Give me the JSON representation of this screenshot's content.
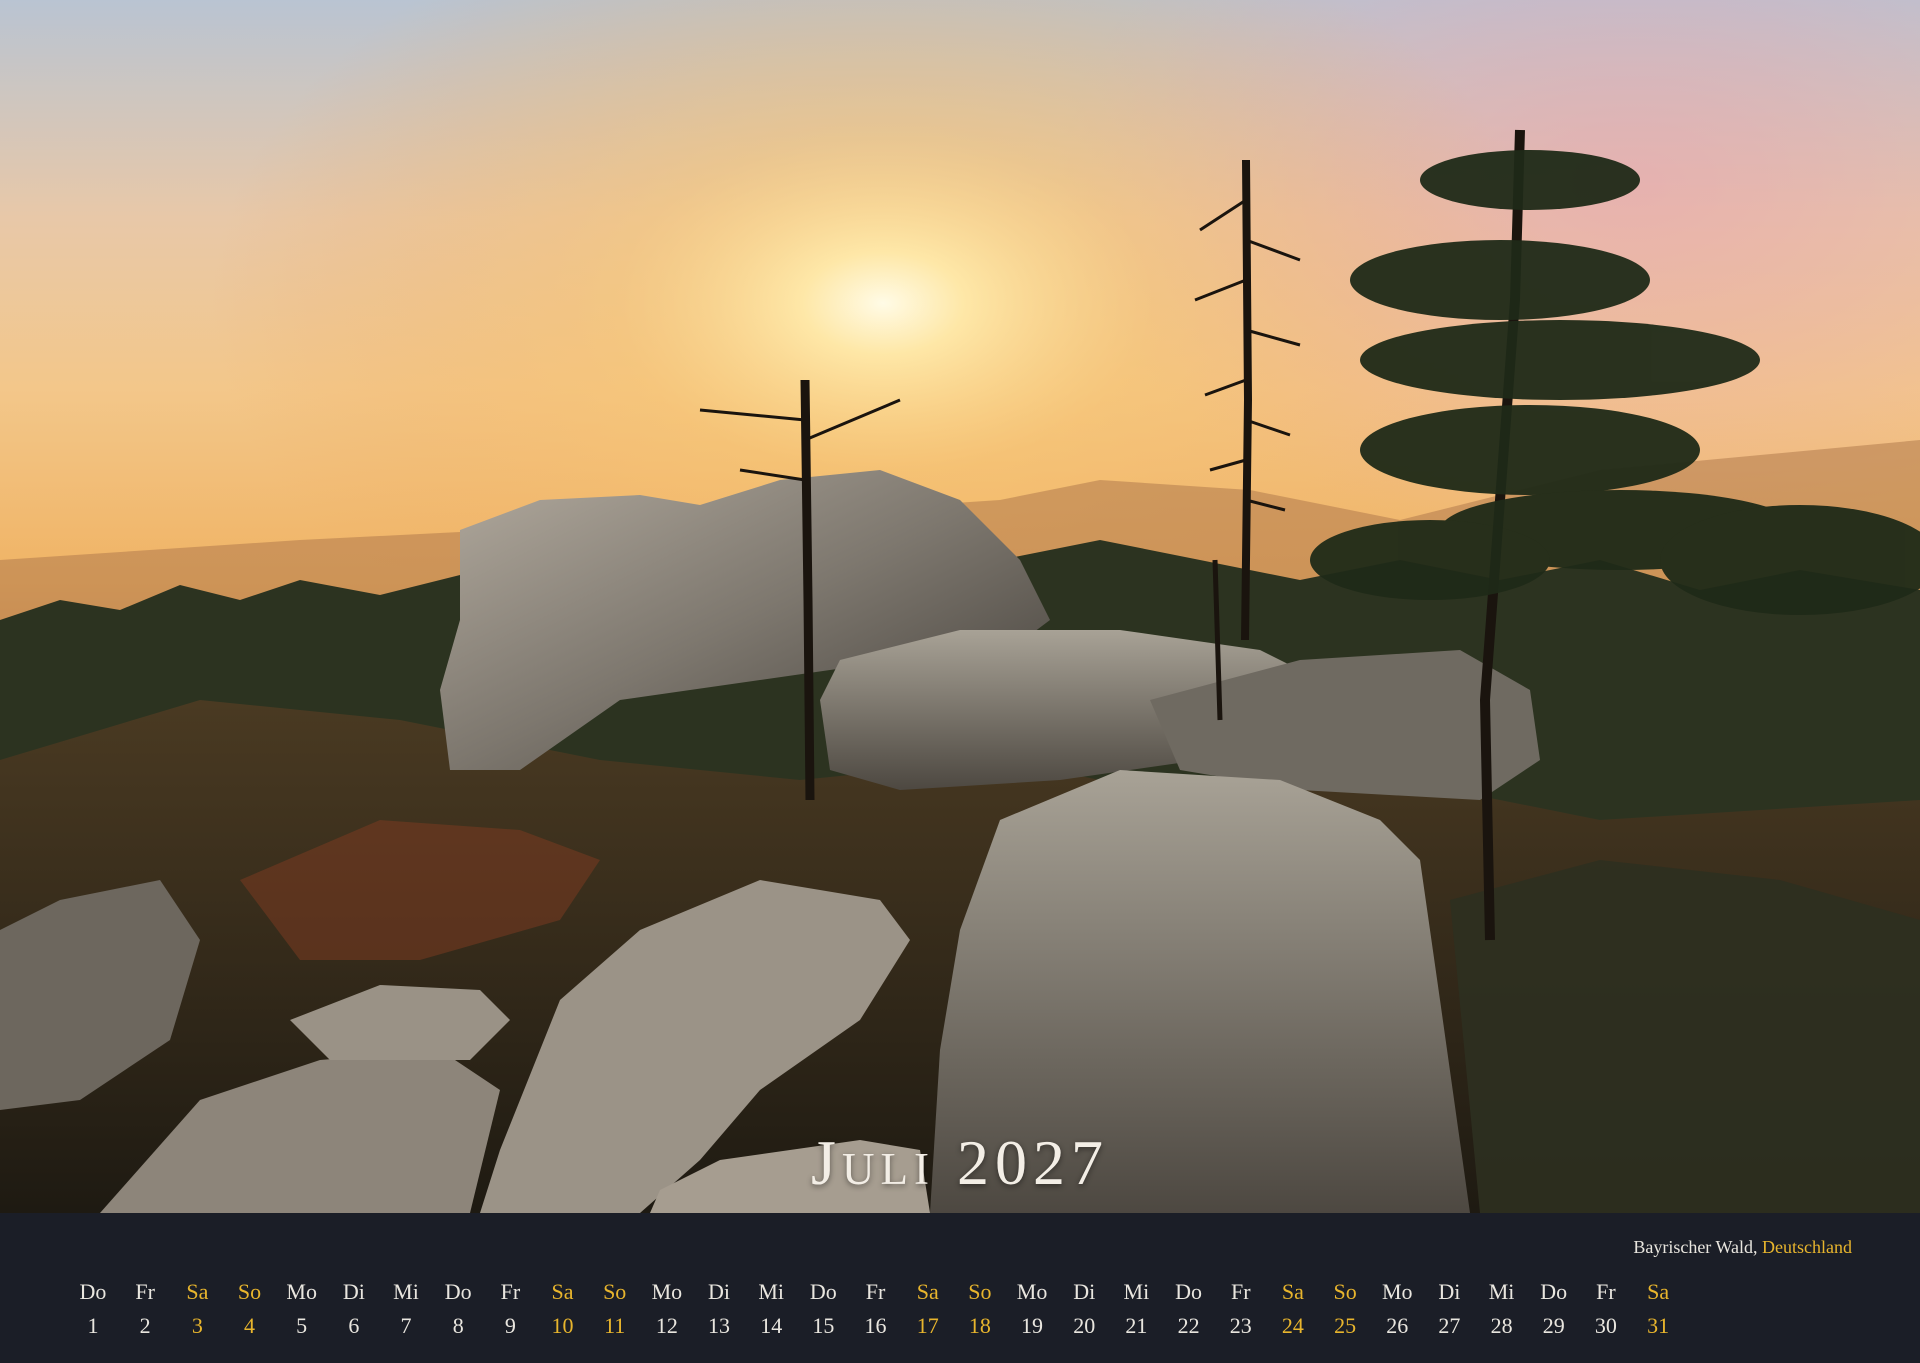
{
  "calendar": {
    "month": "Juli",
    "year": "2027",
    "location": "Bayrischer Wald,",
    "country": "Deutschland"
  },
  "days": [
    {
      "name": "Do",
      "date": "1",
      "weekend": false
    },
    {
      "name": "Fr",
      "date": "2",
      "weekend": false
    },
    {
      "name": "Sa",
      "date": "3",
      "weekend": true
    },
    {
      "name": "So",
      "date": "4",
      "weekend": true
    },
    {
      "name": "Mo",
      "date": "5",
      "weekend": false
    },
    {
      "name": "Di",
      "date": "6",
      "weekend": false
    },
    {
      "name": "Mi",
      "date": "7",
      "weekend": false
    },
    {
      "name": "Do",
      "date": "8",
      "weekend": false
    },
    {
      "name": "Fr",
      "date": "9",
      "weekend": false
    },
    {
      "name": "Sa",
      "date": "10",
      "weekend": true
    },
    {
      "name": "So",
      "date": "11",
      "weekend": true
    },
    {
      "name": "Mo",
      "date": "12",
      "weekend": false
    },
    {
      "name": "Di",
      "date": "13",
      "weekend": false
    },
    {
      "name": "Mi",
      "date": "14",
      "weekend": false
    },
    {
      "name": "Do",
      "date": "15",
      "weekend": false
    },
    {
      "name": "Fr",
      "date": "16",
      "weekend": false
    },
    {
      "name": "Sa",
      "date": "17",
      "weekend": true
    },
    {
      "name": "So",
      "date": "18",
      "weekend": true
    },
    {
      "name": "Mo",
      "date": "19",
      "weekend": false
    },
    {
      "name": "Di",
      "date": "20",
      "weekend": false
    },
    {
      "name": "Mi",
      "date": "21",
      "weekend": false
    },
    {
      "name": "Do",
      "date": "22",
      "weekend": false
    },
    {
      "name": "Fr",
      "date": "23",
      "weekend": false
    },
    {
      "name": "Sa",
      "date": "24",
      "weekend": true
    },
    {
      "name": "So",
      "date": "25",
      "weekend": true
    },
    {
      "name": "Mo",
      "date": "26",
      "weekend": false
    },
    {
      "name": "Di",
      "date": "27",
      "weekend": false
    },
    {
      "name": "Mi",
      "date": "28",
      "weekend": false
    },
    {
      "name": "Do",
      "date": "29",
      "weekend": false
    },
    {
      "name": "Fr",
      "date": "30",
      "weekend": false
    },
    {
      "name": "Sa",
      "date": "31",
      "weekend": true
    }
  ],
  "colors": {
    "footer_background": "#1b1e27",
    "weekday_text": "#e9e6df",
    "weekend_accent": "#e8b52d",
    "title_text": "#f3eee6"
  }
}
